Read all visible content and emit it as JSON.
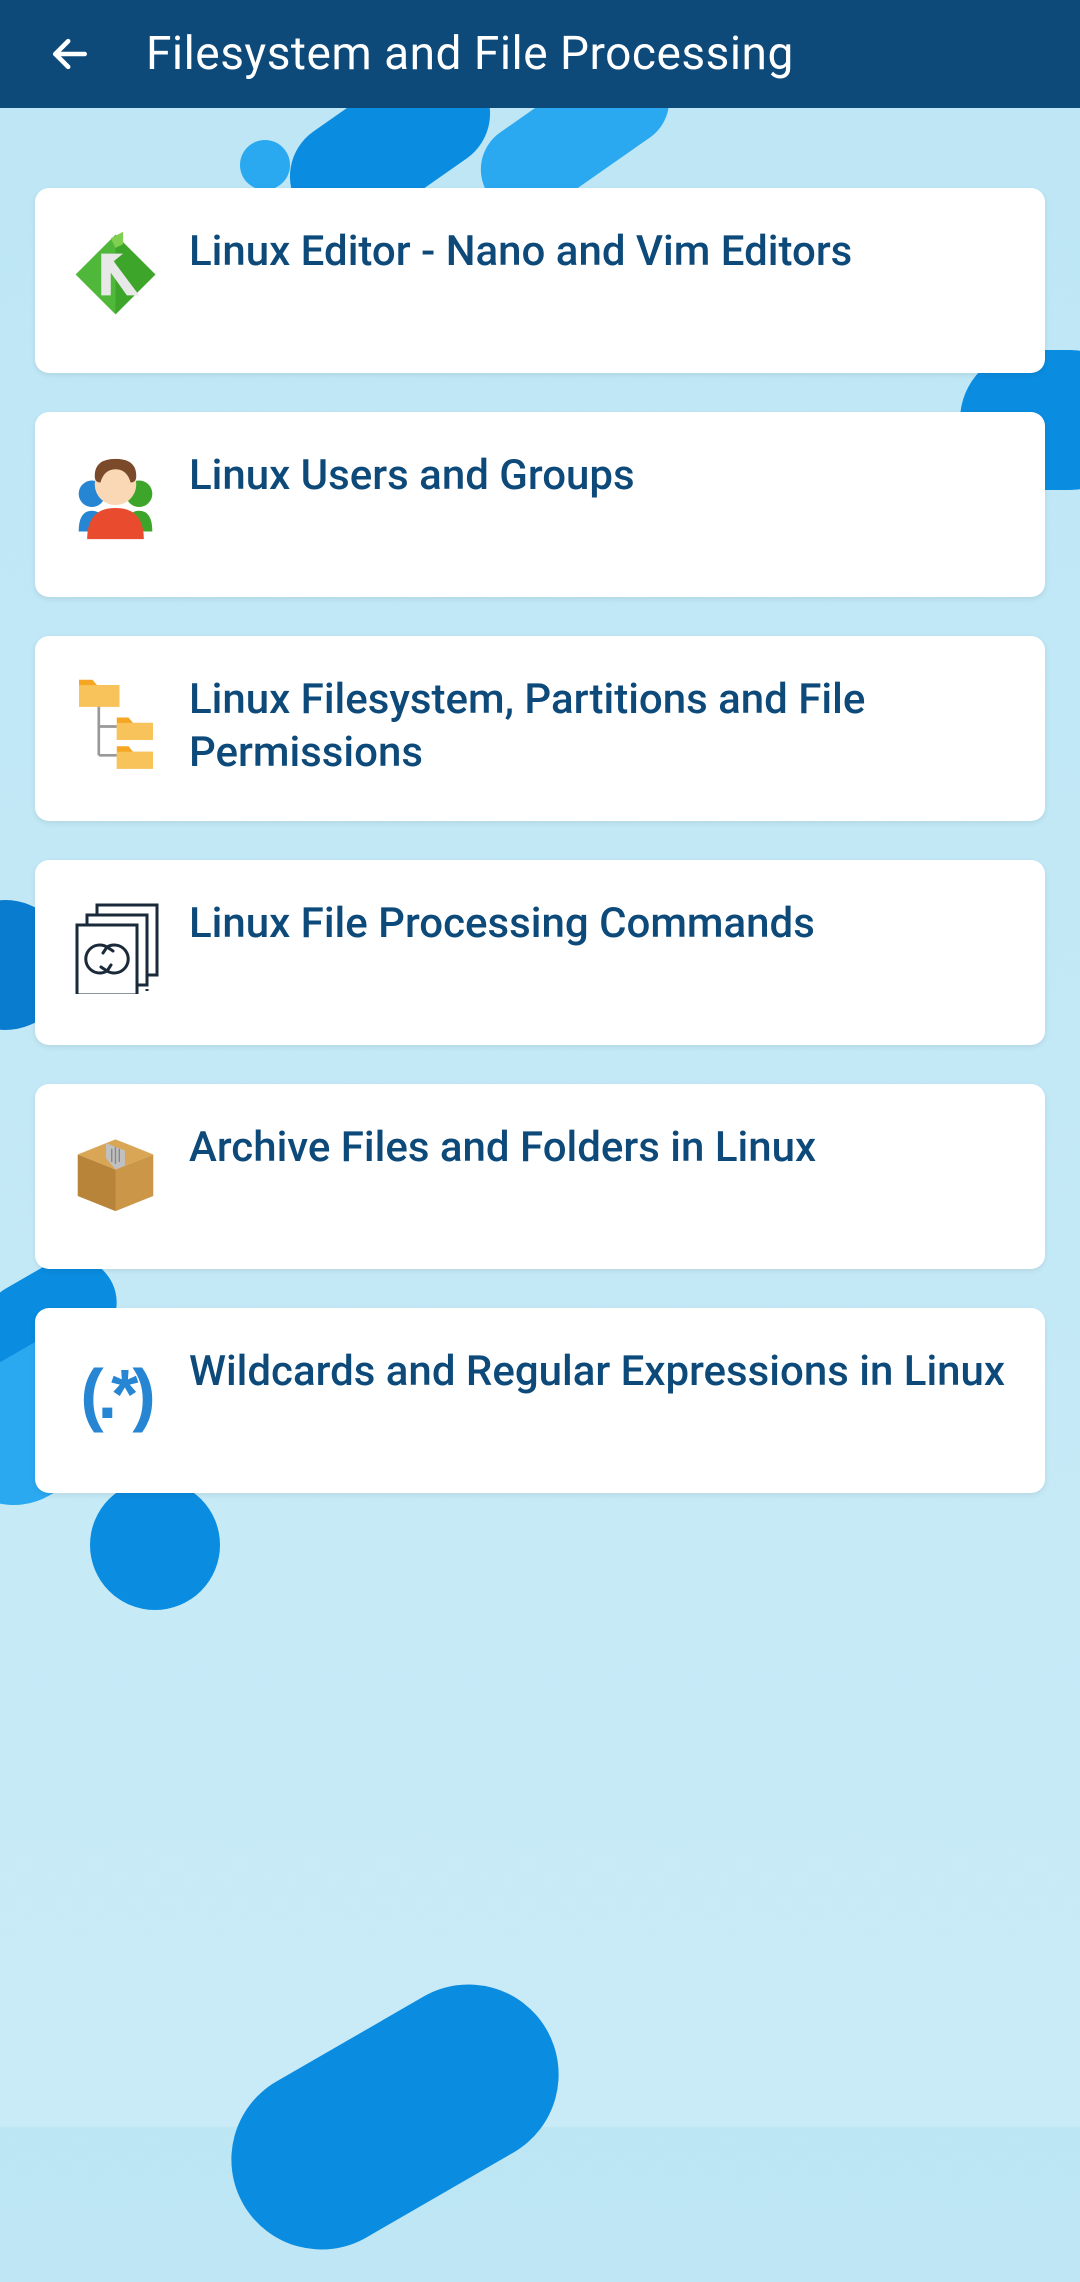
{
  "header": {
    "title": "Filesystem and File Processing"
  },
  "items": [
    {
      "title": "Linux Editor - Nano and Vim Editors",
      "icon": "editor-icon"
    },
    {
      "title": "Linux Users and Groups",
      "icon": "users-icon"
    },
    {
      "title": "Linux Filesystem, Partitions and File Permissions",
      "icon": "filesystem-icon"
    },
    {
      "title": "Linux File Processing Commands",
      "icon": "file-processing-icon"
    },
    {
      "title": "Archive Files and Folders in Linux",
      "icon": "archive-icon"
    },
    {
      "title": "Wildcards and Regular Expressions in Linux",
      "icon": "regex-icon"
    }
  ]
}
